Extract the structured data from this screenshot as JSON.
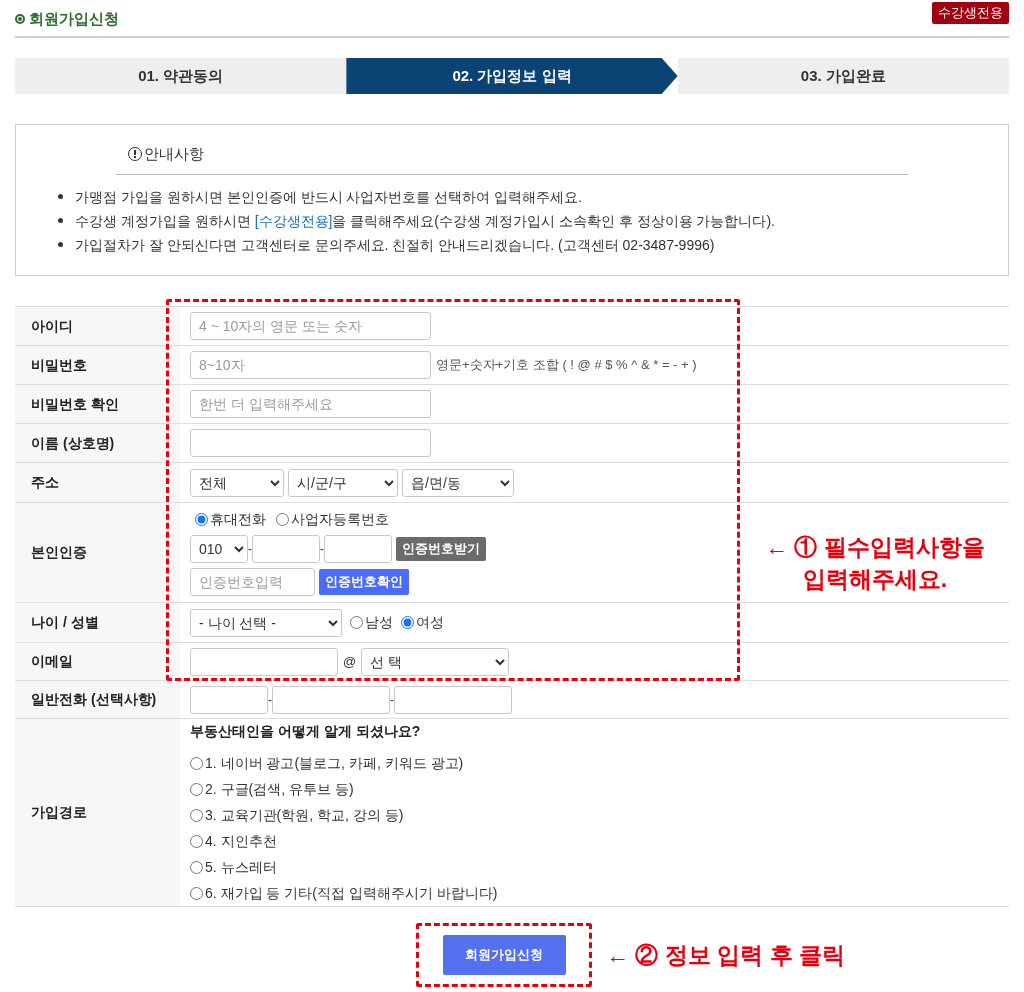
{
  "header": {
    "title": "회원가입신청",
    "badge": "수강생전용"
  },
  "steps": [
    {
      "label": "01. 약관동의",
      "selected": false
    },
    {
      "label": "02. 가입정보 입력",
      "selected": true
    },
    {
      "label": "03. 가입완료",
      "selected": false
    }
  ],
  "notice": {
    "title": "안내사항",
    "items": [
      {
        "text": "가맹점 가입을 원하시면 본인인증에 반드시 사업자번호를 선택하여 입력해주세요."
      },
      {
        "text": "수강생 계정가입을 원하시면 ",
        "link": "[수강생전용]",
        "after": "을 클릭해주세요(수강생 계정가입시 소속확인 후 정상이용 가능합니다)."
      },
      {
        "text": "가입절차가 잘 안되신다면 고객센터로 문의주세요. 친절히 안내드리겠습니다. (고객센터 02-3487-9996)"
      }
    ]
  },
  "form": {
    "rows": [
      {
        "kind": "text",
        "label": "아이디",
        "placeholder": "4 ~ 10자의 영문 또는 숫자"
      },
      {
        "kind": "text",
        "label": "비밀번호",
        "placeholder": "8~10자",
        "hint": "영문+숫자+기호 조합 ( ! @ # $ % ^ & * = - + )"
      },
      {
        "kind": "text",
        "label": "비밀번호 확인",
        "placeholder": "한번 더 입력해주세요"
      },
      {
        "kind": "text",
        "label": "이름 (상호명)"
      },
      {
        "kind": "address",
        "label": "주소",
        "selects": [
          "전체",
          "시/군/구",
          "읍/면/동"
        ]
      },
      {
        "kind": "verify",
        "label": "본인인증",
        "radios": [
          {
            "label": "휴대전화",
            "selected": true
          },
          {
            "label": "사업자등록번호",
            "selected": false
          }
        ],
        "prefix": "010",
        "separators": [
          "-",
          "-"
        ],
        "send_button": "인증번호받기",
        "code_placeholder": "인증번호입력",
        "confirm_button": "인증번호확인"
      },
      {
        "kind": "age_gender",
        "label": "나이 / 성별",
        "select": "- 나이 선택 -",
        "radios": [
          {
            "label": "남성",
            "selected": false
          },
          {
            "label": "여성",
            "selected": true
          }
        ]
      },
      {
        "kind": "email",
        "label": "이메일",
        "at": "@",
        "domain": "선      택"
      },
      {
        "kind": "phone",
        "label": "일반전화 (선택사항)",
        "separators": [
          "-",
          "-"
        ]
      },
      {
        "kind": "survey",
        "label": "가입경로",
        "question": "부동산태인을 어떻게 알게 되셨나요?",
        "options": [
          {
            "label": "1. 네이버 광고(블로그, 카페, 키워드 광고)",
            "selected": false
          },
          {
            "label": "2. 구글(검색, 유투브 등)",
            "selected": false
          },
          {
            "label": "3. 교육기관(학원, 학교, 강의 등)",
            "selected": false
          },
          {
            "label": "4. 지인추천",
            "selected": false
          },
          {
            "label": "5. 뉴스레터",
            "selected": false
          },
          {
            "label": "6. 재가입 등 기타(직접 입력해주시기 바랍니다)",
            "selected": false
          }
        ]
      }
    ]
  },
  "callouts": {
    "required": [
      "← ① 필수입력사항을",
      "입력해주세요."
    ],
    "submit": "← ② 정보 입력 후 클릭"
  },
  "submit_button": "회원가입신청"
}
